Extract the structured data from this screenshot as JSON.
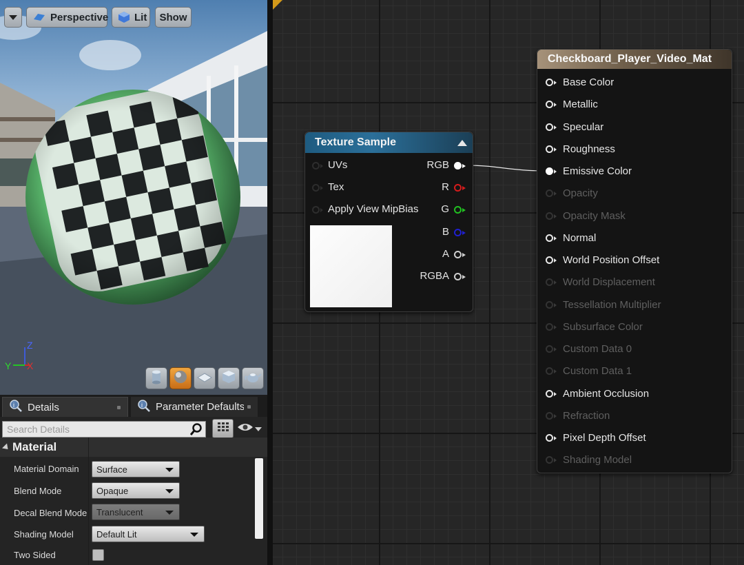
{
  "viewport": {
    "menu_button": "",
    "perspective_label": "Perspective",
    "lit_label": "Lit",
    "show_label": "Show",
    "axis": {
      "z": "Z",
      "y": "Y",
      "x": "X"
    },
    "preview_shapes": [
      "cylinder-icon",
      "sphere-icon",
      "plane-icon",
      "cube-icon",
      "teapot-icon"
    ],
    "active_shape": "sphere-icon"
  },
  "details": {
    "tabs": [
      {
        "label": "Details",
        "icon": "magnifier-info-icon"
      },
      {
        "label": "Parameter Defaults",
        "icon": "magnifier-info-icon"
      }
    ],
    "search_placeholder": "Search Details",
    "section_title": "Material",
    "properties": [
      {
        "label": "Material Domain",
        "value": "Surface"
      },
      {
        "label": "Blend Mode",
        "value": "Opaque"
      },
      {
        "label": "Decal Blend Mode",
        "value": "Translucent"
      },
      {
        "label": "Shading Model",
        "value": "Default Lit"
      },
      {
        "label": "Two Sided",
        "value": ""
      }
    ]
  },
  "graph": {
    "texture_node": {
      "title": "Texture Sample",
      "inputs": [
        "UVs",
        "Tex",
        "Apply View MipBias"
      ],
      "outputs": [
        {
          "label": "RGB",
          "color": "#ffffff"
        },
        {
          "label": "R",
          "color": "#d41c1c"
        },
        {
          "label": "G",
          "color": "#21c021"
        },
        {
          "label": "B",
          "color": "#2020d0"
        },
        {
          "label": "A",
          "color": "#d0d0d0"
        },
        {
          "label": "RGBA",
          "color": "#d0d0d0"
        }
      ]
    },
    "material_node": {
      "title": "Checkboard_Player_Video_Mat",
      "pins": [
        {
          "label": "Base Color",
          "enabled": true
        },
        {
          "label": "Metallic",
          "enabled": true
        },
        {
          "label": "Specular",
          "enabled": true
        },
        {
          "label": "Roughness",
          "enabled": true
        },
        {
          "label": "Emissive Color",
          "enabled": true,
          "connected": true
        },
        {
          "label": "Opacity",
          "enabled": false
        },
        {
          "label": "Opacity Mask",
          "enabled": false
        },
        {
          "label": "Normal",
          "enabled": true
        },
        {
          "label": "World Position Offset",
          "enabled": true
        },
        {
          "label": "World Displacement",
          "enabled": false
        },
        {
          "label": "Tessellation Multiplier",
          "enabled": false
        },
        {
          "label": "Subsurface Color",
          "enabled": false
        },
        {
          "label": "Custom Data 0",
          "enabled": false
        },
        {
          "label": "Custom Data 1",
          "enabled": false
        },
        {
          "label": "Ambient Occlusion",
          "enabled": true
        },
        {
          "label": "Refraction",
          "enabled": false
        },
        {
          "label": "Pixel Depth Offset",
          "enabled": true
        },
        {
          "label": "Shading Model",
          "enabled": false
        }
      ]
    }
  }
}
